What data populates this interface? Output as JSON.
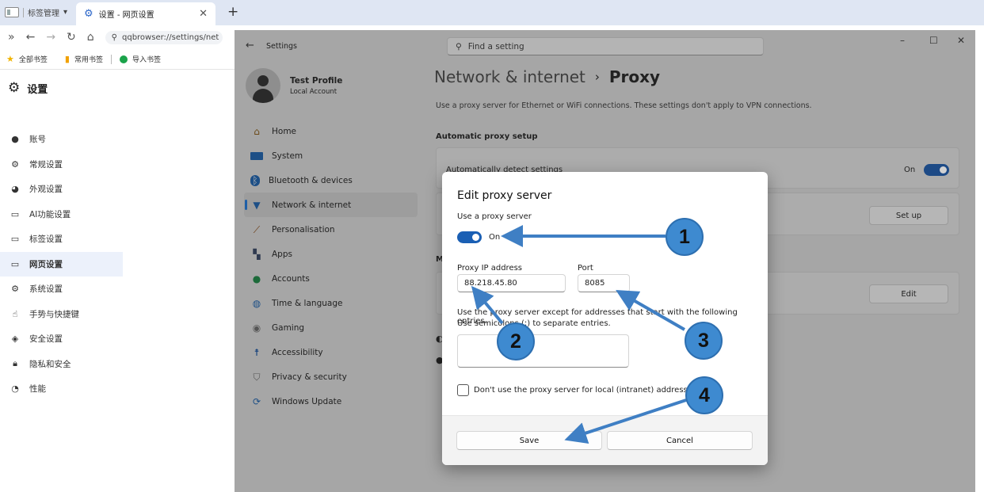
{
  "browser": {
    "tab_manager_label": "标签管理",
    "active_tab_title": "设置 - 网页设置",
    "address": "qqbrowser://settings/net",
    "bookmarks": [
      "全部书签",
      "常用书签",
      "导入书签"
    ]
  },
  "qq_settings": {
    "title": "设置",
    "nav": [
      "账号",
      "常规设置",
      "外观设置",
      "AI功能设置",
      "标签设置",
      "网页设置",
      "系统设置",
      "手势与快捷键",
      "安全设置",
      "隐私和安全",
      "性能"
    ]
  },
  "windows_settings": {
    "window_label": "Settings",
    "search_placeholder": "Find a setting",
    "profile": {
      "name": "Test Profile",
      "account": "Local Account"
    },
    "nav": [
      "Home",
      "System",
      "Bluetooth & devices",
      "Network & internet",
      "Personalisation",
      "Apps",
      "Accounts",
      "Time & language",
      "Gaming",
      "Accessibility",
      "Privacy & security",
      "Windows Update"
    ],
    "breadcrumb": {
      "parent": "Network & internet",
      "current": "Proxy"
    },
    "description": "Use a proxy server for Ethernet or WiFi connections. These settings don't apply to VPN connections.",
    "auto_section": "Automatic proxy setup",
    "auto_detect_label": "Automatically detect settings",
    "auto_detect_state": "On",
    "setup_button": "Set up",
    "manual_section_fragment": "M",
    "edit_button": "Edit"
  },
  "dialog": {
    "title": "Edit proxy server",
    "use_proxy_label": "Use a proxy server",
    "use_proxy_state": "On",
    "ip_label": "Proxy IP address",
    "ip_value": "88.218.45.80",
    "port_label": "Port",
    "port_value": "8085",
    "exceptions_line1": "Use the proxy server except for addresses that start with the following entries.",
    "exceptions_line2": "Use semicolons (;) to separate entries.",
    "local_checkbox_label": "Don't use the proxy server for local (intranet) addresses",
    "save": "Save",
    "cancel": "Cancel"
  },
  "callouts": [
    "1",
    "2",
    "3",
    "4"
  ],
  "colors": {
    "callout": "#3e8ad0",
    "toggle": "#1a5fb4",
    "arrow": "#3f7fc4"
  }
}
